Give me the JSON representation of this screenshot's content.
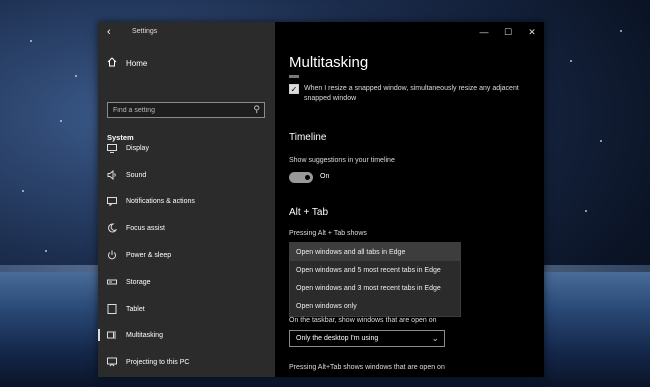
{
  "window": {
    "title": "Settings",
    "controls": [
      "—",
      "☐",
      "✕"
    ]
  },
  "sidebar": {
    "home_label": "Home",
    "search_placeholder": "Find a setting",
    "section": "System",
    "items": [
      {
        "label": "Display",
        "icon": "monitor-icon"
      },
      {
        "label": "Sound",
        "icon": "speaker-icon"
      },
      {
        "label": "Notifications & actions",
        "icon": "notifications-icon"
      },
      {
        "label": "Focus assist",
        "icon": "moon-icon"
      },
      {
        "label": "Power & sleep",
        "icon": "power-icon"
      },
      {
        "label": "Storage",
        "icon": "storage-icon"
      },
      {
        "label": "Tablet",
        "icon": "tablet-icon"
      },
      {
        "label": "Multitasking",
        "icon": "multitasking-icon",
        "selected": true
      },
      {
        "label": "Projecting to this PC",
        "icon": "projecting-icon"
      }
    ]
  },
  "main": {
    "title": "Multitasking",
    "snap_checkbox_label": "When I resize a snapped window, simultaneously resize any adjacent snapped window",
    "timeline_heading": "Timeline",
    "timeline_label": "Show suggestions in your timeline",
    "toggle_state": "On",
    "alttab_heading": "Alt + Tab",
    "alttab_label": "Pressing Alt + Tab shows",
    "alttab_options": [
      "Open windows and all tabs in Edge",
      "Open windows and 5 most recent tabs in Edge",
      "Open windows and 3 most recent tabs in Edge",
      "Open windows only"
    ],
    "taskbar_label": "On the taskbar, show windows that are open on",
    "taskbar_value": "Only the desktop I'm using",
    "bottom_label": "Pressing Alt+Tab shows windows that are open on"
  }
}
